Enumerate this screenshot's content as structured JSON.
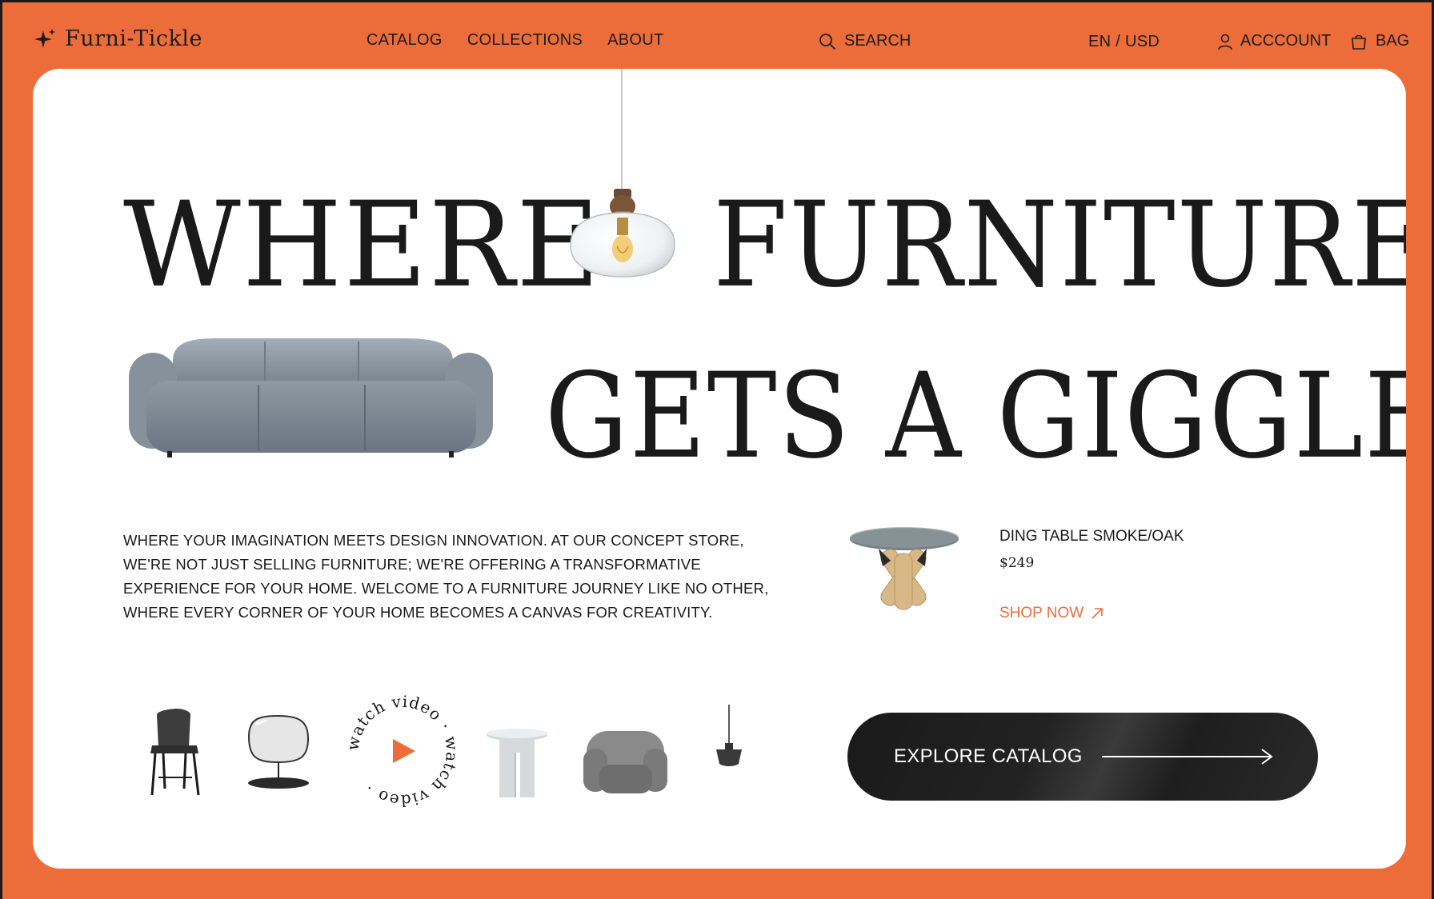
{
  "brand": {
    "name": "Furni-Tickle"
  },
  "nav": [
    {
      "label": "CATALOG"
    },
    {
      "label": "COLLECTIONS"
    },
    {
      "label": "ABOUT"
    }
  ],
  "search": {
    "placeholder": "SEARCH"
  },
  "locale": {
    "label": "EN / USD"
  },
  "account": {
    "label": "ACCCOUNT"
  },
  "bag": {
    "label": "BAG"
  },
  "hero": {
    "word_where": "WHERE",
    "word_furniture": "FURNITURE",
    "word_giggle": "GETS A GIGGLE"
  },
  "intro": "WHERE YOUR IMAGINATION MEETS DESIGN INNOVATION. AT OUR CONCEPT STORE, WE'RE NOT JUST SELLING FURNITURE; WE'RE OFFERING A TRANSFORMATIVE EXPERIENCE FOR YOUR HOME.  WELCOME TO A FURNITURE JOURNEY LIKE NO OTHER, WHERE EVERY CORNER OF YOUR HOME BECOMES A CANVAS FOR CREATIVITY.",
  "featured": {
    "name": "DING TABLE SMOKE/OAK",
    "price": "$249",
    "cta": "SHOP NOW"
  },
  "watch_video": {
    "ring_text": "watch video · watch video · "
  },
  "explore": {
    "label": "EXPLORE CATALOG"
  },
  "colors": {
    "accent": "#ec6d3a",
    "dark": "#1a1a1a",
    "card": "#ffffff"
  }
}
